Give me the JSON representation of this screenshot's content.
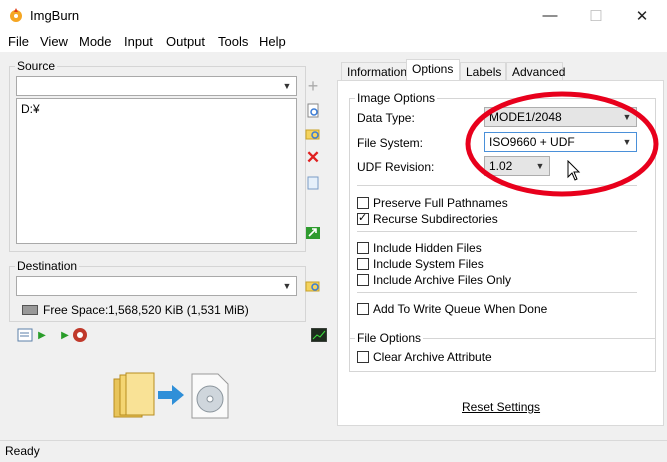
{
  "window": {
    "title": "ImgBurn",
    "minimize": "—",
    "maximize": "☐",
    "close": "✕"
  },
  "menu": [
    "File",
    "View",
    "Mode",
    "Input",
    "Output",
    "Tools",
    "Help"
  ],
  "source": {
    "label": "Source",
    "combo_value": "",
    "list_items": [
      "D:¥"
    ]
  },
  "destination": {
    "label": "Destination",
    "combo_value": "",
    "free_space_label": "Free Space:",
    "free_space_value": "1,568,520 KiB  (1,531 MiB)"
  },
  "tabs": [
    "Information",
    "Options",
    "Labels",
    "Advanced"
  ],
  "active_tab": "Options",
  "image_options": {
    "label": "Image Options",
    "data_type_label": "Data Type:",
    "data_type_value": "MODE1/2048",
    "file_system_label": "File System:",
    "file_system_value": "ISO9660 + UDF",
    "udf_revision_label": "UDF Revision:",
    "udf_revision_value": "1.02"
  },
  "checkboxes": [
    {
      "label": "Preserve Full Pathnames",
      "checked": false
    },
    {
      "label": "Recurse Subdirectories",
      "checked": true
    },
    {
      "label": "Include Hidden Files",
      "checked": false
    },
    {
      "label": "Include System Files",
      "checked": false
    },
    {
      "label": "Include Archive Files Only",
      "checked": false
    },
    {
      "label": "Add To Write Queue When Done",
      "checked": false
    }
  ],
  "file_options": {
    "label": "File Options",
    "clear_archive": {
      "label": "Clear Archive Attribute",
      "checked": false
    }
  },
  "reset_settings": "Reset Settings",
  "status": "Ready",
  "colors": {
    "annotation_ellipse": "#e8001c",
    "link": "#000000"
  }
}
